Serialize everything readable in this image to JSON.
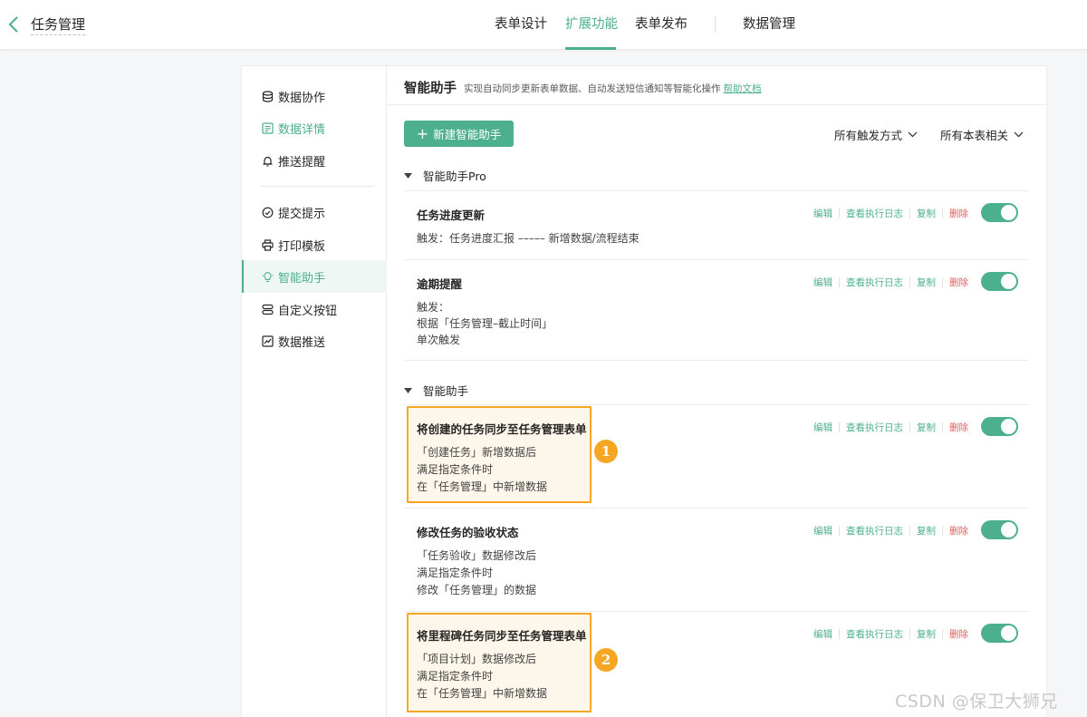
{
  "topbar": {
    "title": "任务管理",
    "tabs": [
      "表单设计",
      "扩展功能",
      "表单发布",
      "数据管理"
    ]
  },
  "sidebar": {
    "items": [
      {
        "label": "数据协作",
        "icon": "database-icon"
      },
      {
        "label": "数据详情",
        "icon": "detail-icon"
      },
      {
        "label": "推送提醒",
        "icon": "bell-icon"
      },
      {
        "label": "提交提示",
        "icon": "check-circle-icon"
      },
      {
        "label": "打印模板",
        "icon": "printer-icon"
      },
      {
        "label": "智能助手",
        "icon": "lightbulb-icon"
      },
      {
        "label": "自定义按钮",
        "icon": "button-icon"
      },
      {
        "label": "数据推送",
        "icon": "chart-icon"
      }
    ]
  },
  "main": {
    "title": "智能助手",
    "subtitle": "实现自动同步更新表单数据、自动发送短信通知等智能化操作",
    "help_link": "帮助文档",
    "new_button": "新建智能助手",
    "filter_trigger": "所有触发方式",
    "filter_related": "所有本表相关",
    "actions": {
      "edit": "编辑",
      "log": "查看执行日志",
      "copy": "复制",
      "delete": "删除"
    },
    "groups": [
      {
        "name": "智能助手Pro",
        "cards": [
          {
            "title": "任务进度更新",
            "lines": [
              "触发：任务进度汇报 ––––– 新增数据/流程结束"
            ]
          },
          {
            "title": "逾期提醒",
            "lines": [
              "触发：",
              "根据「任务管理–截止时间」",
              "单次触发"
            ]
          }
        ]
      },
      {
        "name": "智能助手",
        "cards": [
          {
            "title": "将创建的任务同步至任务管理表单",
            "lines": [
              "「创建任务」新增数据后",
              "满足指定条件时",
              "在「任务管理」中新增数据"
            ],
            "badge": "1"
          },
          {
            "title": "修改任务的验收状态",
            "lines": [
              "「任务验收」数据修改后",
              "满足指定条件时",
              "修改「任务管理」的数据"
            ]
          },
          {
            "title": "将里程碑任务同步至任务管理表单",
            "lines": [
              "「项目计划」数据修改后",
              "满足指定条件时",
              "在「任务管理」中新增数据"
            ],
            "badge": "2"
          }
        ]
      }
    ]
  },
  "watermark": "CSDN @保卫大狮兄",
  "colors": {
    "accent": "#4caf8e",
    "highlight": "#f5a623",
    "danger": "#e0605b"
  }
}
